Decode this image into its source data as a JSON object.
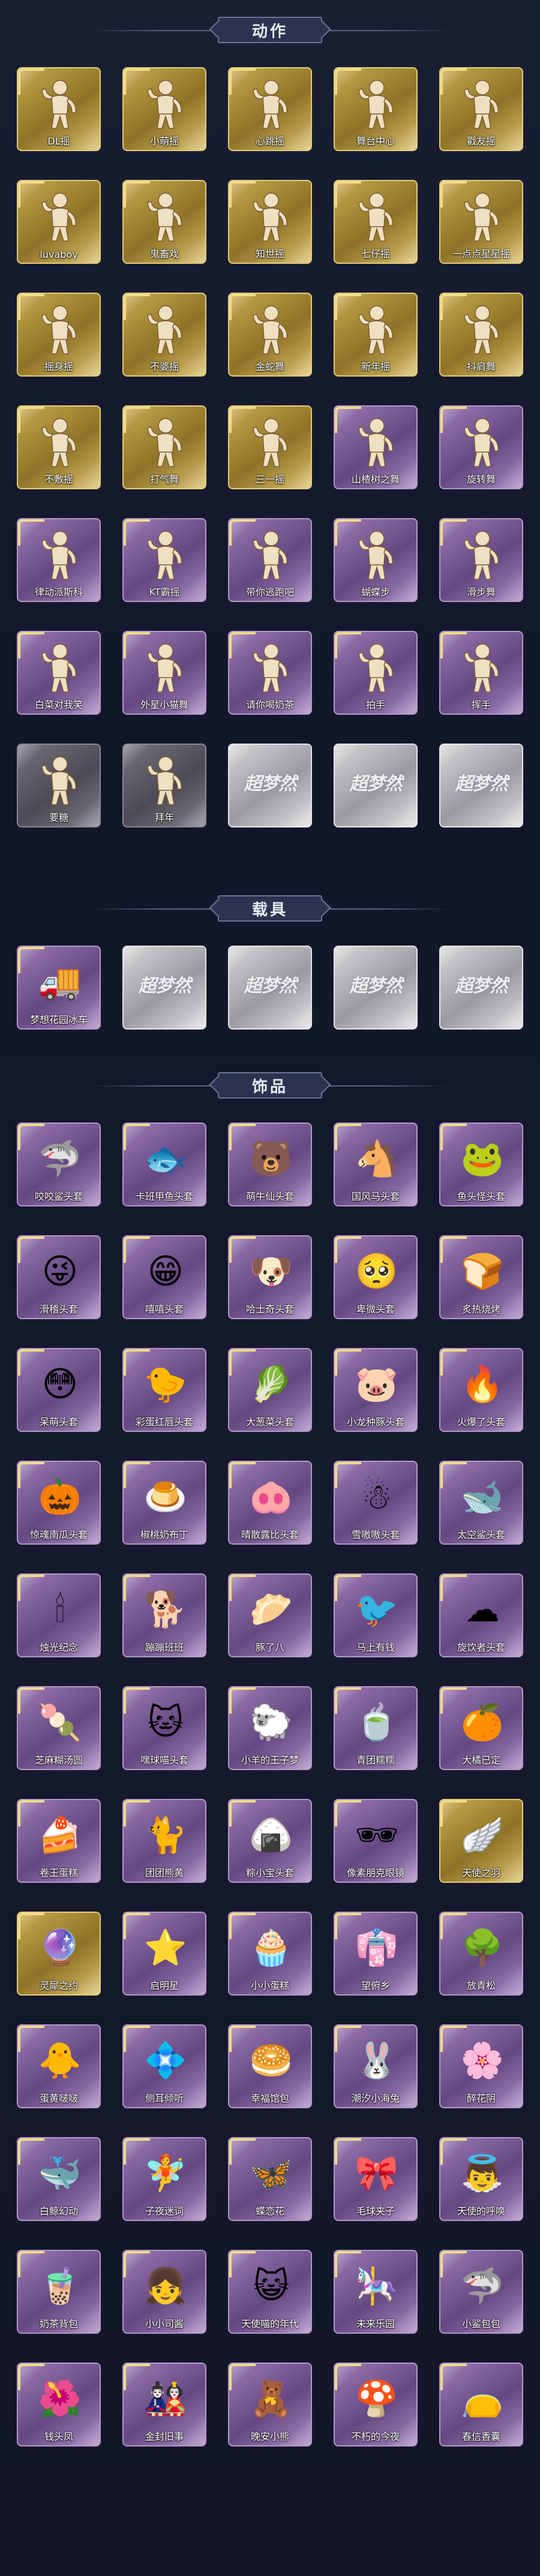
{
  "sections": [
    {
      "title": "动作",
      "items": [
        {
          "label": "DL摇",
          "tier": "gold",
          "icon": "dance-figure-icon"
        },
        {
          "label": "小萌摇",
          "tier": "gold",
          "icon": "dance-figure-icon"
        },
        {
          "label": "心跳摇",
          "tier": "gold",
          "icon": "dance-figure-icon"
        },
        {
          "label": "舞台中心",
          "tier": "gold",
          "icon": "dance-figure-icon"
        },
        {
          "label": "戳友摇",
          "tier": "gold",
          "icon": "dance-figure-icon"
        },
        {
          "label": "luvaboy",
          "tier": "gold",
          "icon": "dance-figure-icon"
        },
        {
          "label": "鬼畜戏",
          "tier": "gold",
          "icon": "dance-figure-icon"
        },
        {
          "label": "知世摇",
          "tier": "gold",
          "icon": "dance-figure-icon"
        },
        {
          "label": "七仔摇",
          "tier": "gold",
          "icon": "dance-figure-icon"
        },
        {
          "label": "一点点星星摇",
          "tier": "gold",
          "icon": "dance-figure-icon"
        },
        {
          "label": "摇身摇",
          "tier": "gold",
          "icon": "dance-figure-icon"
        },
        {
          "label": "不婆摇",
          "tier": "gold",
          "icon": "dance-figure-icon"
        },
        {
          "label": "金蛇舞",
          "tier": "gold",
          "icon": "dance-figure-icon"
        },
        {
          "label": "新年摇",
          "tier": "gold",
          "icon": "dance-figure-icon"
        },
        {
          "label": "抖肩舞",
          "tier": "gold",
          "icon": "dance-figure-icon"
        },
        {
          "label": "不敷摇",
          "tier": "gold",
          "icon": "dance-figure-icon"
        },
        {
          "label": "打气舞",
          "tier": "gold",
          "icon": "dance-figure-icon"
        },
        {
          "label": "三一摇",
          "tier": "gold",
          "icon": "dance-figure-icon"
        },
        {
          "label": "山楂树之舞",
          "tier": "purple",
          "icon": "dance-figure-icon"
        },
        {
          "label": "旋转舞",
          "tier": "purple",
          "icon": "dance-figure-icon"
        },
        {
          "label": "律动派斯科",
          "tier": "purple",
          "icon": "dance-figure-icon"
        },
        {
          "label": "KT霸摇",
          "tier": "purple",
          "icon": "dance-figure-icon"
        },
        {
          "label": "带你逃跑吧",
          "tier": "purple",
          "icon": "dance-figure-icon"
        },
        {
          "label": "蝴蝶步",
          "tier": "purple",
          "icon": "dance-figure-icon"
        },
        {
          "label": "滑步舞",
          "tier": "purple",
          "icon": "dance-figure-icon"
        },
        {
          "label": "白菜对我笑",
          "tier": "purple",
          "icon": "dance-figure-icon"
        },
        {
          "label": "外星小猫舞",
          "tier": "purple",
          "icon": "dance-figure-icon"
        },
        {
          "label": "请你喝奶茶",
          "tier": "purple",
          "icon": "dance-figure-icon"
        },
        {
          "label": "拍手",
          "tier": "purple",
          "icon": "dance-figure-icon"
        },
        {
          "label": "挥手",
          "tier": "purple",
          "icon": "dance-figure-icon"
        },
        {
          "label": "要糖",
          "tier": "gray",
          "icon": "dance-figure-icon"
        },
        {
          "label": "拜年",
          "tier": "gray",
          "icon": "dance-figure-icon"
        },
        {
          "label": "",
          "tier": "silver",
          "icon": "placeholder-logo-icon",
          "watermark": "超梦然"
        },
        {
          "label": "",
          "tier": "silver",
          "icon": "placeholder-logo-icon",
          "watermark": "超梦然"
        },
        {
          "label": "",
          "tier": "silver",
          "icon": "placeholder-logo-icon",
          "watermark": "超梦然"
        }
      ]
    },
    {
      "title": "载具",
      "items": [
        {
          "label": "梦想花园冰车",
          "tier": "purple",
          "icon": "ice-cream-truck-icon",
          "glyph": "🚚"
        },
        {
          "label": "",
          "tier": "silver",
          "icon": "placeholder-logo-icon",
          "watermark": "超梦然"
        },
        {
          "label": "",
          "tier": "silver",
          "icon": "placeholder-logo-icon",
          "watermark": "超梦然"
        },
        {
          "label": "",
          "tier": "silver",
          "icon": "placeholder-logo-icon",
          "watermark": "超梦然"
        },
        {
          "label": "",
          "tier": "silver",
          "icon": "placeholder-logo-icon",
          "watermark": "超梦然"
        }
      ]
    },
    {
      "title": "饰品",
      "items": [
        {
          "label": "咬咬鲨头套",
          "tier": "purple",
          "icon": "shark-head-icon",
          "glyph": "🦈"
        },
        {
          "label": "卡班甲鱼头套",
          "tier": "purple",
          "icon": "fish-head-icon",
          "glyph": "🐟"
        },
        {
          "label": "萌牛仙头套",
          "tier": "purple",
          "icon": "bear-head-icon",
          "glyph": "🐻"
        },
        {
          "label": "国风马头套",
          "tier": "purple",
          "icon": "horse-head-icon",
          "glyph": "🐴"
        },
        {
          "label": "鱼头怪头套",
          "tier": "purple",
          "icon": "fish-monster-head-icon",
          "glyph": "🐸"
        },
        {
          "label": "滑稽头套",
          "tier": "purple",
          "icon": "funny-face-icon",
          "glyph": "😜"
        },
        {
          "label": "嘻嘻头套",
          "tier": "purple",
          "icon": "grin-face-icon",
          "glyph": "😁"
        },
        {
          "label": "哈士奇头套",
          "tier": "purple",
          "icon": "husky-head-icon",
          "glyph": "🐶"
        },
        {
          "label": "卑微头套",
          "tier": "purple",
          "icon": "humble-face-icon",
          "glyph": "🥺"
        },
        {
          "label": "炙热烧烤",
          "tier": "purple",
          "icon": "toast-head-icon",
          "glyph": "🍞"
        },
        {
          "label": "呆萌头套",
          "tier": "purple",
          "icon": "dazed-face-icon",
          "glyph": "😳"
        },
        {
          "label": "彩蛋红唇头套",
          "tier": "purple",
          "icon": "pikachu-head-icon",
          "glyph": "🐤"
        },
        {
          "label": "大葱菜头套",
          "tier": "purple",
          "icon": "bok-choy-head-icon",
          "glyph": "🥬"
        },
        {
          "label": "小龙种豚头套",
          "tier": "purple",
          "icon": "piglet-head-icon",
          "glyph": "🐷"
        },
        {
          "label": "火爆了头套",
          "tier": "purple",
          "icon": "fire-head-icon",
          "glyph": "🔥"
        },
        {
          "label": "惊魂南瓜头套",
          "tier": "purple",
          "icon": "pumpkin-head-icon",
          "glyph": "🎃"
        },
        {
          "label": "椒桃奶布丁",
          "tier": "purple",
          "icon": "pudding-head-icon",
          "glyph": "🍮"
        },
        {
          "label": "晴散露比头套",
          "tier": "purple",
          "icon": "pink-pig-head-icon",
          "glyph": "🐽"
        },
        {
          "label": "雪嗷嗷头套",
          "tier": "purple",
          "icon": "snowman-head-icon",
          "glyph": "☃"
        },
        {
          "label": "太空鲨头套",
          "tier": "purple",
          "icon": "space-shark-head-icon",
          "glyph": "🐋"
        },
        {
          "label": "烛光纪念",
          "tier": "purple",
          "icon": "candle-head-icon",
          "glyph": "🕯"
        },
        {
          "label": "蹦蹦班班",
          "tier": "purple",
          "icon": "dog-head-icon",
          "glyph": "🐕"
        },
        {
          "label": "豚了八",
          "tier": "purple",
          "icon": "dumpling-head-icon",
          "glyph": "🥟"
        },
        {
          "label": "马上有钱",
          "tier": "purple",
          "icon": "pink-bird-head-icon",
          "glyph": "🐦"
        },
        {
          "label": "旋饮者头套",
          "tier": "purple",
          "icon": "cloud-head-icon",
          "glyph": "☁"
        },
        {
          "label": "芝麻糊汤圆",
          "tier": "purple",
          "icon": "rice-ball-head-icon",
          "glyph": "🍡"
        },
        {
          "label": "嘿球喵头套",
          "tier": "purple",
          "icon": "black-cat-head-icon",
          "glyph": "🐱"
        },
        {
          "label": "小羊的王子梦",
          "tier": "purple",
          "icon": "lamb-head-icon",
          "glyph": "🐑"
        },
        {
          "label": "青团糯糯",
          "tier": "purple",
          "icon": "green-rice-ball-icon",
          "glyph": "🍵"
        },
        {
          "label": "大橘已定",
          "tier": "purple",
          "icon": "orange-head-icon",
          "glyph": "🍊"
        },
        {
          "label": "卷王蛋糕",
          "tier": "purple",
          "icon": "cake-roll-head-icon",
          "glyph": "🍰"
        },
        {
          "label": "团团熊黄",
          "tier": "purple",
          "icon": "yellow-cat-head-icon",
          "glyph": "🐈"
        },
        {
          "label": "粽小宝头套",
          "tier": "purple",
          "icon": "zongzi-head-icon",
          "glyph": "🍙"
        },
        {
          "label": "像素朋克眼镜",
          "tier": "purple",
          "icon": "pixel-glasses-icon",
          "glyph": "🕶"
        },
        {
          "label": "天使之羽",
          "tier": "gold",
          "icon": "angel-wings-icon",
          "glyph": "🪽"
        },
        {
          "label": "灵犀之约",
          "tier": "gold",
          "icon": "spirit-orb-icon",
          "glyph": "🔮"
        },
        {
          "label": "启明星",
          "tier": "purple",
          "icon": "star-headdress-icon",
          "glyph": "⭐"
        },
        {
          "label": "小小蛋糕",
          "tier": "purple",
          "icon": "mini-cake-icon",
          "glyph": "🧁"
        },
        {
          "label": "望俯乡",
          "tier": "purple",
          "icon": "costume-girl-icon",
          "glyph": "👘"
        },
        {
          "label": "放青松",
          "tier": "purple",
          "icon": "bonsai-tree-icon",
          "glyph": "🌳"
        },
        {
          "label": "蛋黄啵啵",
          "tier": "purple",
          "icon": "egg-yolk-backpack-icon",
          "glyph": "🐥"
        },
        {
          "label": "侧耳倾听",
          "tier": "purple",
          "icon": "ear-accessory-icon",
          "glyph": "💠"
        },
        {
          "label": "幸福馆包",
          "tier": "purple",
          "icon": "bun-backpack-icon",
          "glyph": "🥯"
        },
        {
          "label": "潮汐小海兔",
          "tier": "purple",
          "icon": "sea-rabbit-icon",
          "glyph": "🐰"
        },
        {
          "label": "醉花阴",
          "tier": "purple",
          "icon": "flower-ornament-icon",
          "glyph": "🌸"
        },
        {
          "label": "白鲸幻动",
          "tier": "purple",
          "icon": "beluga-backpack-icon",
          "glyph": "🐳"
        },
        {
          "label": "子夜迷词",
          "tier": "purple",
          "icon": "night-fairy-icon",
          "glyph": "🧚"
        },
        {
          "label": "蝶恋花",
          "tier": "purple",
          "icon": "butterfly-backpack-icon",
          "glyph": "🦋"
        },
        {
          "label": "毛球夹子",
          "tier": "purple",
          "icon": "pompom-clip-icon",
          "glyph": "🎀"
        },
        {
          "label": "天使的呼唤",
          "tier": "purple",
          "icon": "angel-doll-icon",
          "glyph": "👼"
        },
        {
          "label": "奶茶背包",
          "tier": "purple",
          "icon": "milk-tea-backpack-icon",
          "glyph": "🧋"
        },
        {
          "label": "小小司酱",
          "tier": "purple",
          "icon": "little-doll-icon",
          "glyph": "👧"
        },
        {
          "label": "天使喵的年代",
          "tier": "purple",
          "icon": "angel-cat-doll-icon",
          "glyph": "😺"
        },
        {
          "label": "未来乐园",
          "tier": "purple",
          "icon": "pink-doll-icon",
          "glyph": "🎠"
        },
        {
          "label": "小鲨包包",
          "tier": "purple",
          "icon": "shark-bag-icon",
          "glyph": "🦈"
        },
        {
          "label": "钱头凤",
          "tier": "purple",
          "icon": "phoenix-doll-icon",
          "glyph": "🌺"
        },
        {
          "label": "金封旧事",
          "tier": "purple",
          "icon": "dark-doll-icon",
          "glyph": "🎎"
        },
        {
          "label": "晚安小熊",
          "tier": "purple",
          "icon": "teddy-bear-icon",
          "glyph": "🧸"
        },
        {
          "label": "不朽的今夜",
          "tier": "purple",
          "icon": "mushroom-doll-icon",
          "glyph": "🍄"
        },
        {
          "label": "春信香囊",
          "tier": "purple",
          "icon": "sachet-icon",
          "glyph": "👝"
        }
      ]
    }
  ]
}
